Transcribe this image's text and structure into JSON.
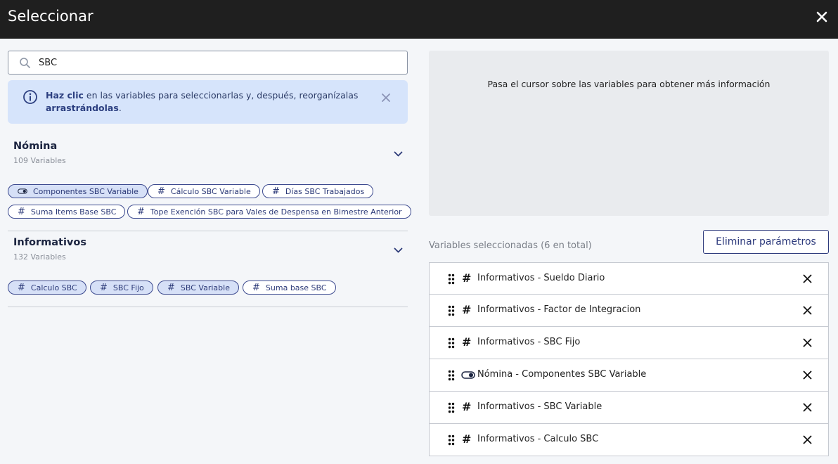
{
  "header": {
    "title": "Seleccionar"
  },
  "search": {
    "value": "SBC"
  },
  "info": {
    "bold1": "Haz clic",
    "text1": " en las variables para seleccionarlas y, después, reorganízalas ",
    "bold2": "arrastrándolas",
    "text2": "."
  },
  "groups": [
    {
      "title": "Nómina",
      "count": "109 Variables",
      "chips": [
        {
          "label": "Componentes SBC Variable",
          "icon": "toggle-icon",
          "selected": true
        },
        {
          "label": "Cálculo SBC Variable",
          "icon": "hash-icon",
          "selected": false
        },
        {
          "label": "Días SBC Trabajados",
          "icon": "hash-icon",
          "selected": false
        },
        {
          "label": "Suma Items Base SBC",
          "icon": "hash-icon",
          "selected": false
        },
        {
          "label": "Tope Exención SBC para Vales de Despensa en Bimestre Anterior",
          "icon": "hash-icon",
          "selected": false
        }
      ]
    },
    {
      "title": "Informativos",
      "count": "132 Variables",
      "chips": [
        {
          "label": "Calculo SBC",
          "icon": "hash-icon",
          "selected": true
        },
        {
          "label": "SBC Fijo",
          "icon": "hash-icon",
          "selected": true
        },
        {
          "label": "SBC Variable",
          "icon": "hash-icon",
          "selected": true
        },
        {
          "label": "Suma base SBC",
          "icon": "hash-icon",
          "selected": false
        }
      ]
    }
  ],
  "preview": {
    "text": "Pasa el cursor sobre las variables para obtener más información"
  },
  "selected": {
    "count_label": "Variables seleccionadas (6 en total)",
    "clear_label": "Eliminar parámetros",
    "items": [
      {
        "label": "Informativos - Sueldo Diario",
        "icon": "hash-icon"
      },
      {
        "label": "Informativos - Factor de Integracion",
        "icon": "hash-icon"
      },
      {
        "label": "Informativos - SBC Fijo",
        "icon": "hash-icon"
      },
      {
        "label": "Nómina - Componentes SBC Variable",
        "icon": "toggle-icon"
      },
      {
        "label": "Informativos - SBC Variable",
        "icon": "hash-icon"
      },
      {
        "label": "Informativos - Calculo SBC",
        "icon": "hash-icon"
      }
    ]
  }
}
